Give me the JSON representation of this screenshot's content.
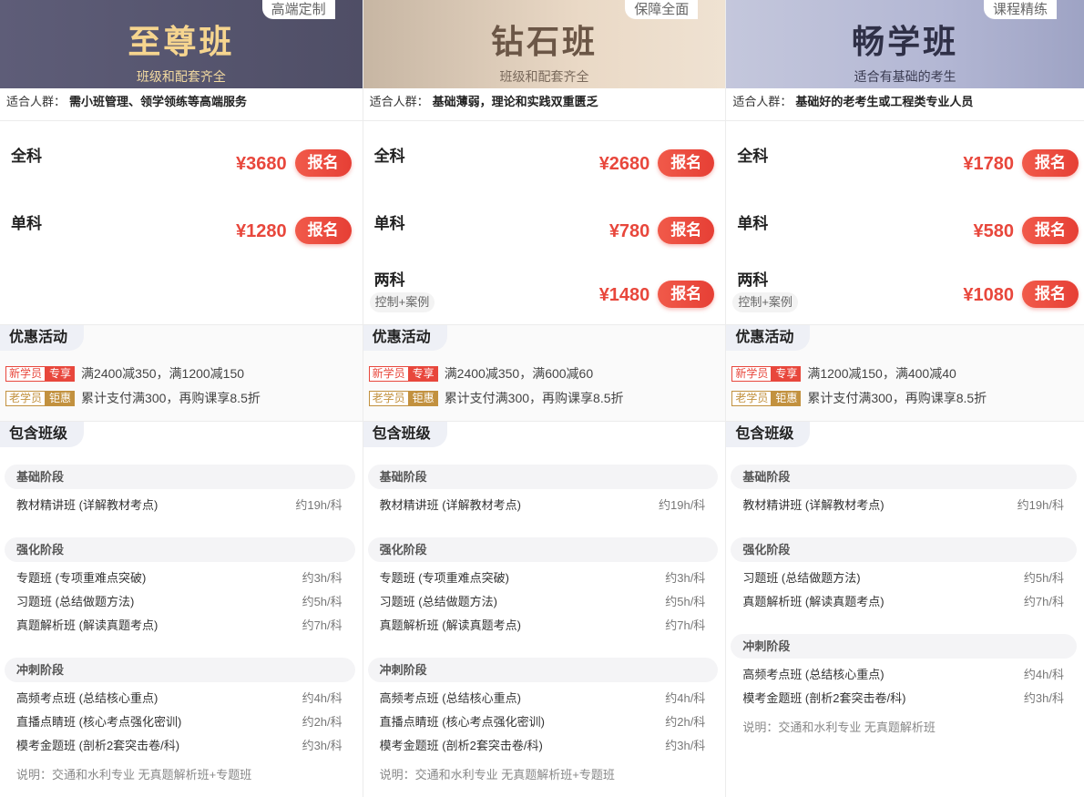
{
  "labels": {
    "audience": "适合人群：",
    "promo": "优惠活动",
    "classes": "包含班级",
    "enroll": "报名"
  },
  "plans": [
    {
      "badge": "高端定制",
      "title": "至尊班",
      "subtitle": "班级和配套齐全",
      "audience": "需小班管理、领学领练等高端服务",
      "prices": [
        {
          "name": "全科",
          "tag": "",
          "price": "¥3680"
        },
        {
          "name": "单科",
          "tag": "",
          "price": "¥1280"
        }
      ],
      "promos": [
        {
          "tag_a": "新学员",
          "tag_b": "专享",
          "text": "满2400减350，满1200减150"
        },
        {
          "tag_a": "老学员",
          "tag_b": "钜惠",
          "text": "累计支付满300，再购课享8.5折"
        }
      ],
      "stages": [
        {
          "name": "基础阶段",
          "items": [
            {
              "name": "教材精讲班 (详解教材考点)",
              "hours": "约19h/科"
            }
          ]
        },
        {
          "name": "强化阶段",
          "items": [
            {
              "name": "专题班 (专项重难点突破)",
              "hours": "约3h/科"
            },
            {
              "name": "习题班 (总结做题方法)",
              "hours": "约5h/科"
            },
            {
              "name": "真题解析班 (解读真题考点)",
              "hours": "约7h/科"
            }
          ]
        },
        {
          "name": "冲刺阶段",
          "items": [
            {
              "name": "高频考点班 (总结核心重点)",
              "hours": "约4h/科"
            },
            {
              "name": "直播点睛班 (核心考点强化密训)",
              "hours": "约2h/科"
            },
            {
              "name": "模考金题班 (剖析2套突击卷/科)",
              "hours": "约3h/科"
            }
          ]
        }
      ],
      "note": "说明：交通和水利专业 无真题解析班+专题班"
    },
    {
      "badge": "保障全面",
      "title": "钻石班",
      "subtitle": "班级和配套齐全",
      "audience": "基础薄弱，理论和实践双重匮乏",
      "prices": [
        {
          "name": "全科",
          "tag": "",
          "price": "¥2680"
        },
        {
          "name": "单科",
          "tag": "",
          "price": "¥780"
        },
        {
          "name": "两科",
          "tag": "控制+案例",
          "price": "¥1480"
        }
      ],
      "promos": [
        {
          "tag_a": "新学员",
          "tag_b": "专享",
          "text": "满2400减350，满600减60"
        },
        {
          "tag_a": "老学员",
          "tag_b": "钜惠",
          "text": "累计支付满300，再购课享8.5折"
        }
      ],
      "stages": [
        {
          "name": "基础阶段",
          "items": [
            {
              "name": "教材精讲班 (详解教材考点)",
              "hours": "约19h/科"
            }
          ]
        },
        {
          "name": "强化阶段",
          "items": [
            {
              "name": "专题班 (专项重难点突破)",
              "hours": "约3h/科"
            },
            {
              "name": "习题班 (总结做题方法)",
              "hours": "约5h/科"
            },
            {
              "name": "真题解析班 (解读真题考点)",
              "hours": "约7h/科"
            }
          ]
        },
        {
          "name": "冲刺阶段",
          "items": [
            {
              "name": "高频考点班 (总结核心重点)",
              "hours": "约4h/科"
            },
            {
              "name": "直播点睛班 (核心考点强化密训)",
              "hours": "约2h/科"
            },
            {
              "name": "模考金题班 (剖析2套突击卷/科)",
              "hours": "约3h/科"
            }
          ]
        }
      ],
      "note": "说明：交通和水利专业 无真题解析班+专题班"
    },
    {
      "badge": "课程精练",
      "title": "畅学班",
      "subtitle": "适合有基础的考生",
      "audience": "基础好的老考生或工程类专业人员",
      "prices": [
        {
          "name": "全科",
          "tag": "",
          "price": "¥1780"
        },
        {
          "name": "单科",
          "tag": "",
          "price": "¥580"
        },
        {
          "name": "两科",
          "tag": "控制+案例",
          "price": "¥1080"
        }
      ],
      "promos": [
        {
          "tag_a": "新学员",
          "tag_b": "专享",
          "text": "满1200减150，满400减40"
        },
        {
          "tag_a": "老学员",
          "tag_b": "钜惠",
          "text": "累计支付满300，再购课享8.5折"
        }
      ],
      "stages": [
        {
          "name": "基础阶段",
          "items": [
            {
              "name": "教材精讲班 (详解教材考点)",
              "hours": "约19h/科"
            }
          ]
        },
        {
          "name": "强化阶段",
          "items": [
            {
              "name": "习题班 (总结做题方法)",
              "hours": "约5h/科"
            },
            {
              "name": "真题解析班 (解读真题考点)",
              "hours": "约7h/科"
            }
          ]
        },
        {
          "name": "冲刺阶段",
          "items": [
            {
              "name": "高频考点班 (总结核心重点)",
              "hours": "约4h/科"
            },
            {
              "name": "模考金题班 (剖析2套突击卷/科)",
              "hours": "约3h/科"
            }
          ]
        }
      ],
      "note": "说明：交通和水利专业 无真题解析班"
    }
  ]
}
